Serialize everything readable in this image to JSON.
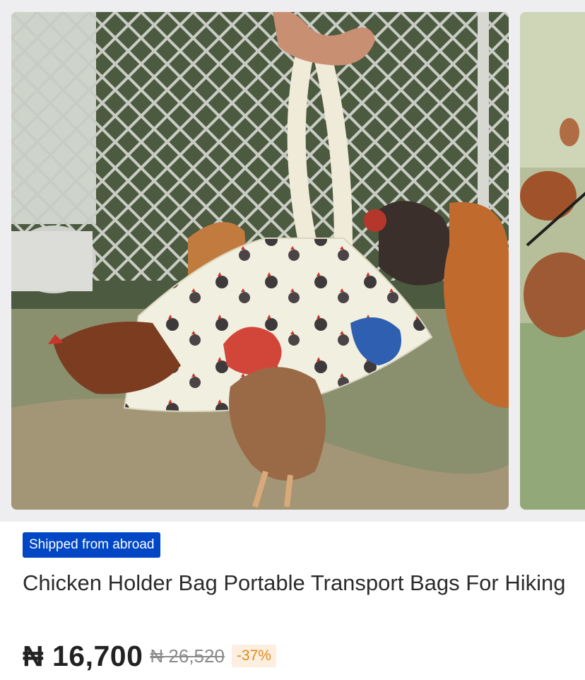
{
  "gallery": {
    "main_image_alt": "Chicken holder bag carried by hand with a hen inside, legs hanging out, in a chicken coop",
    "next_image_alt": "Next product photo with chickens"
  },
  "product": {
    "shipping_badge": "Shipped from abroad",
    "title": "Chicken Holder Bag Portable Transport Bags For Hiking",
    "price": "₦ 16,700",
    "old_price": "₦ 26,520",
    "discount": "-37%"
  },
  "colors": {
    "badge_bg": "#0047c6",
    "discount_text": "#e08a1a",
    "discount_bg": "#fdefe0"
  }
}
